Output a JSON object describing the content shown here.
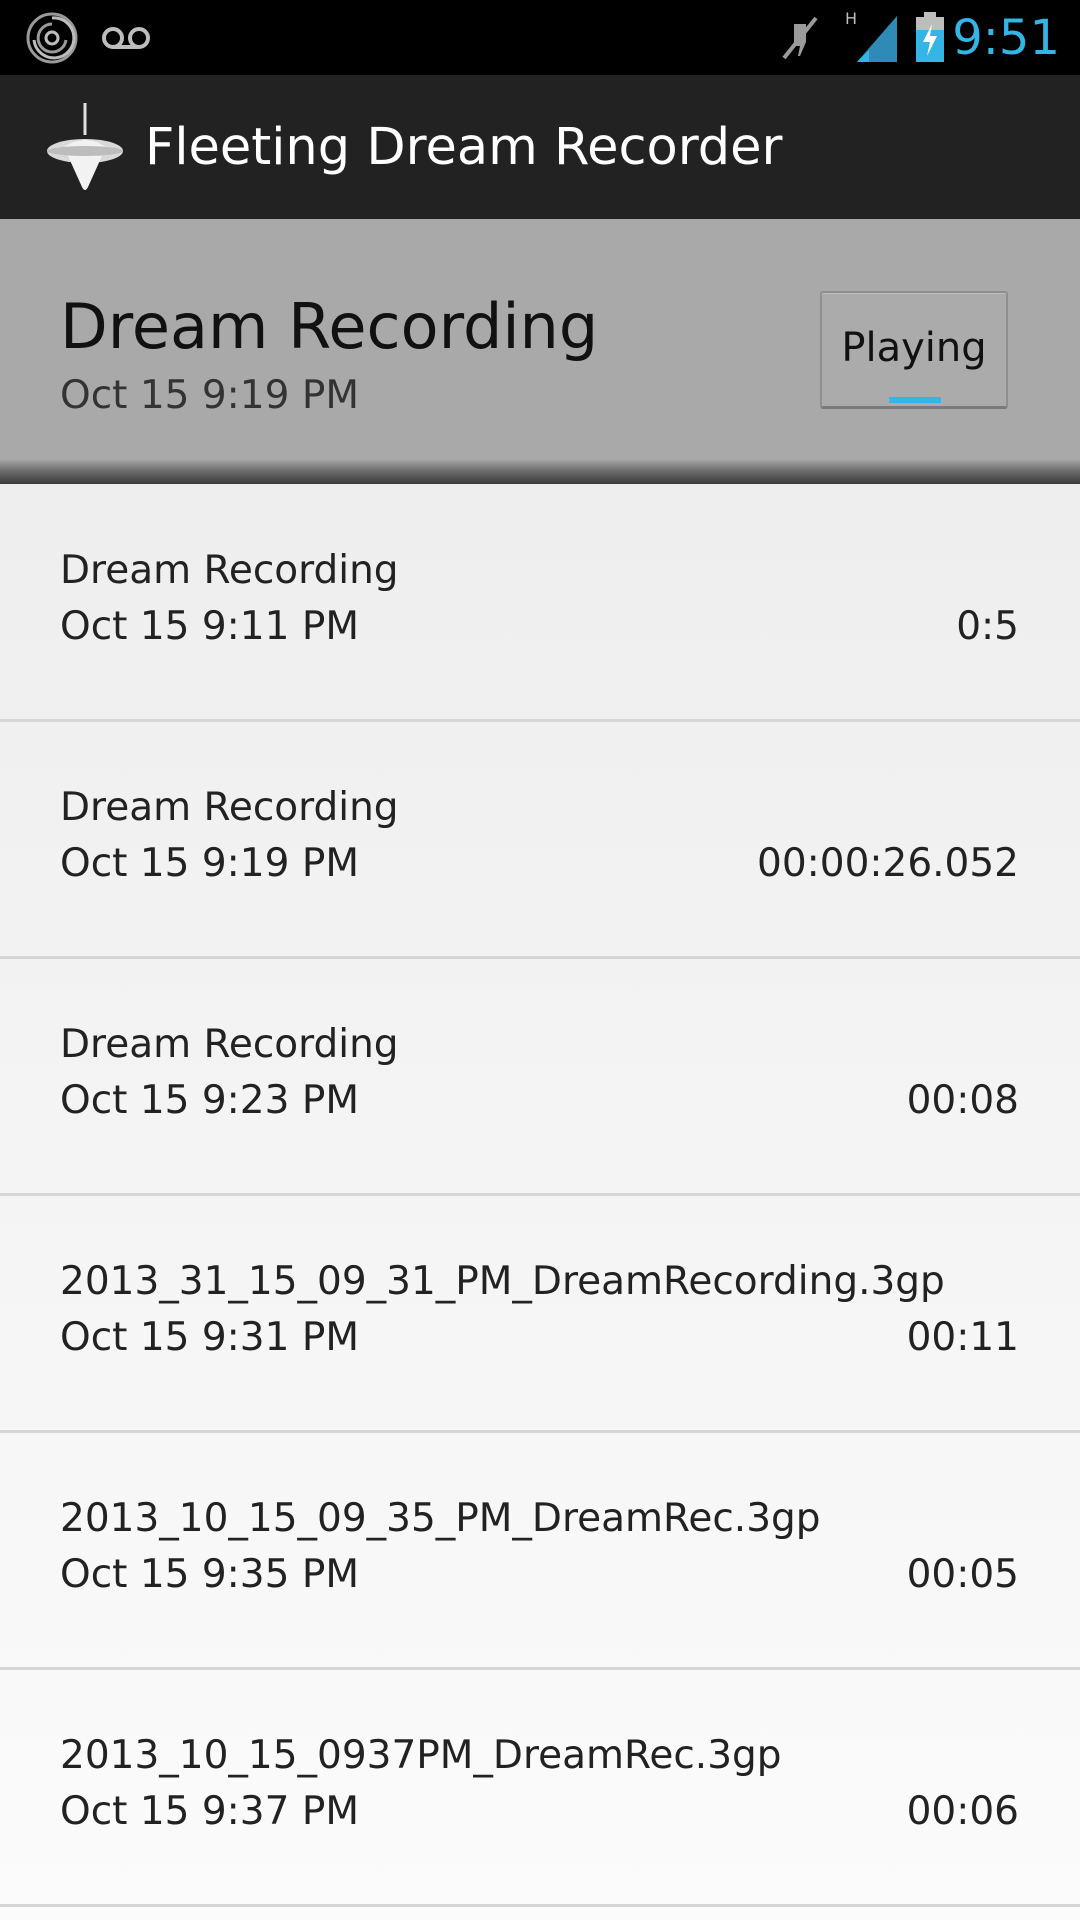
{
  "status_bar": {
    "time": "9:51",
    "icons": [
      "spiral-app-icon",
      "voicemail-icon",
      "mute-icon",
      "signal-h-icon",
      "battery-charging-icon"
    ],
    "accent_color": "#33b5e5"
  },
  "action_bar": {
    "app_icon": "spinning-top-icon",
    "title": "Fleeting Dream Recorder"
  },
  "now_playing": {
    "title": "Dream Recording",
    "date": "Oct 15 9:19 PM",
    "button_label": "Playing"
  },
  "recordings": [
    {
      "name": "Dream Recording",
      "date": "Oct 15 9:11 PM",
      "duration": "0:5"
    },
    {
      "name": "Dream Recording",
      "date": "Oct 15 9:19 PM",
      "duration": "00:00:26.052"
    },
    {
      "name": "Dream Recording",
      "date": "Oct 15 9:23 PM",
      "duration": "00:08"
    },
    {
      "name": "2013_31_15_09_31_PM_DreamRecording.3gp",
      "date": "Oct 15 9:31 PM",
      "duration": "00:11"
    },
    {
      "name": "2013_10_15_09_35_PM_DreamRec.3gp",
      "date": "Oct 15 9:35 PM",
      "duration": "00:05"
    },
    {
      "name": "2013_10_15_0937PM_DreamRec.3gp",
      "date": "Oct 15 9:37 PM",
      "duration": "00:06"
    }
  ]
}
